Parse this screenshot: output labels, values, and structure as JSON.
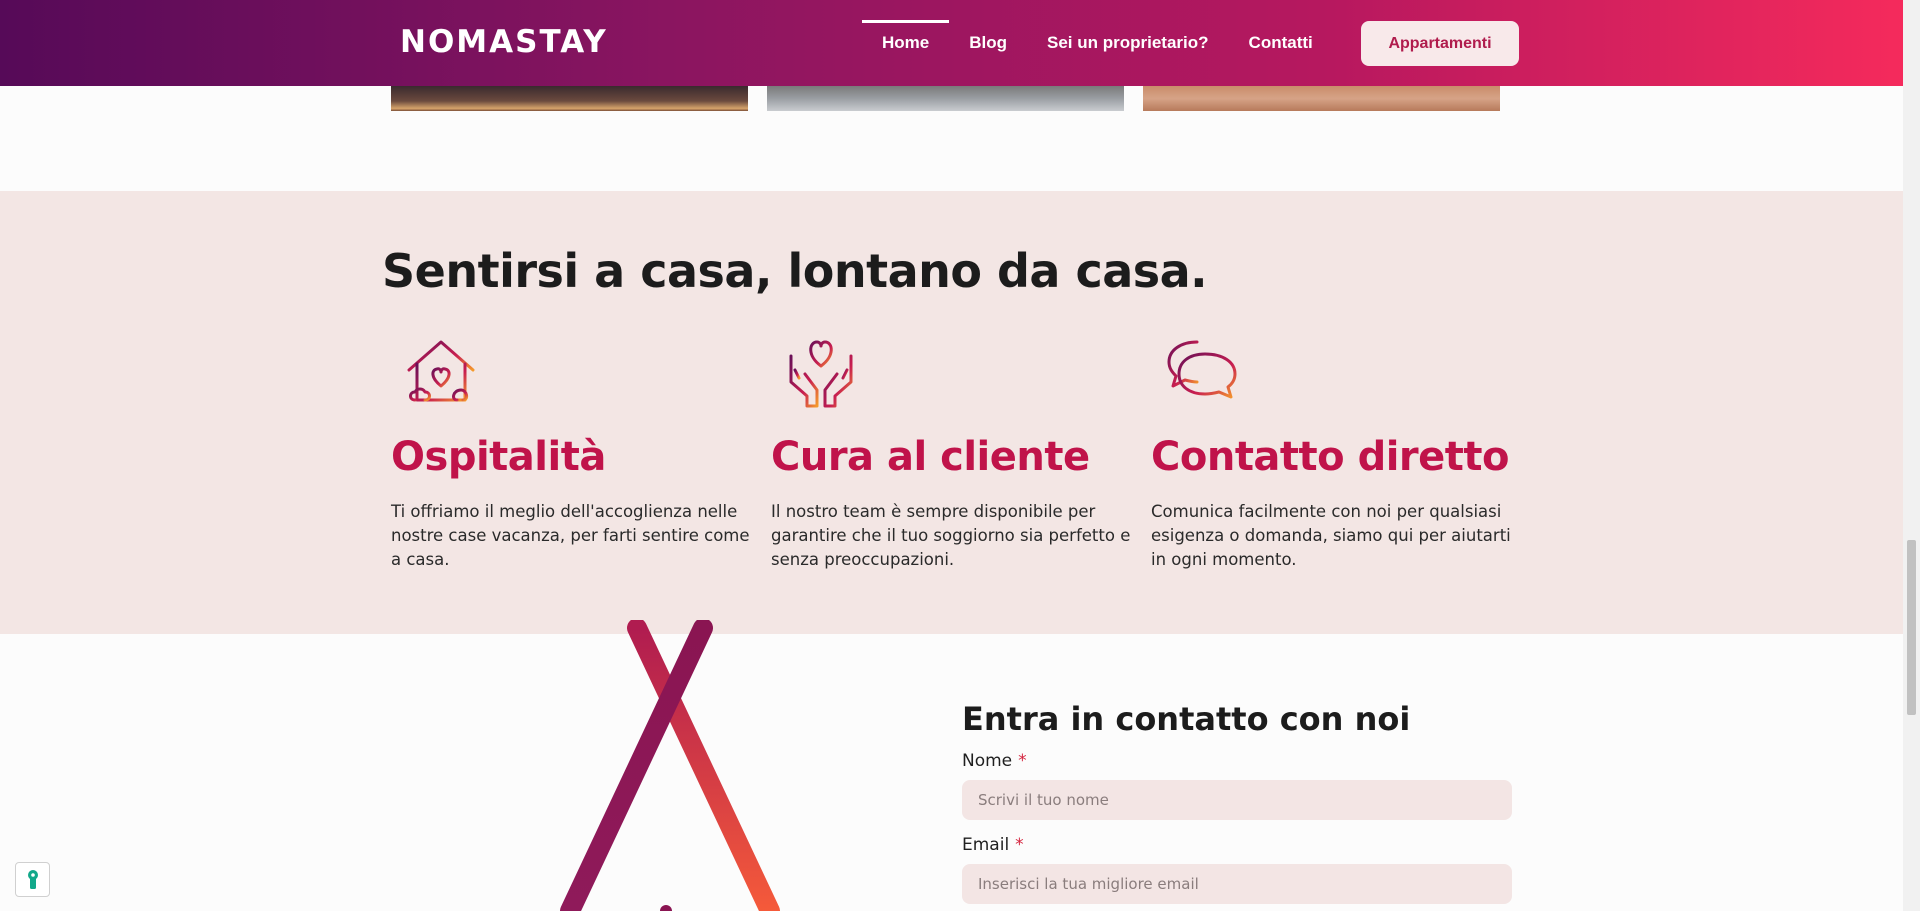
{
  "header": {
    "logo": "NOMASTAY",
    "nav": [
      {
        "label": "Home",
        "active": true
      },
      {
        "label": "Blog",
        "active": false
      },
      {
        "label": "Sei un proprietario?",
        "active": false
      },
      {
        "label": "Contatti",
        "active": false
      }
    ],
    "cta_label": "Appartamenti"
  },
  "features": {
    "title": "Sentirsi a casa, lontano da casa.",
    "items": [
      {
        "icon": "house-heart-icon",
        "title": "Ospitalità",
        "text": "Ti offriamo il meglio dell'accoglienza nelle nostre case vacanza, per farti sentire come a casa."
      },
      {
        "icon": "hands-heart-icon",
        "title": "Cura al cliente",
        "text": "Il nostro team è sempre disponibile per garantire che il tuo soggiorno sia perfetto e senza preoccupazioni."
      },
      {
        "icon": "chat-bubbles-icon",
        "title": "Contatto diretto",
        "text": "Comunica facilmente con noi per qualsiasi esigenza o domanda, siamo qui per aiutarti in ogni momento."
      }
    ]
  },
  "contact": {
    "title": "Entra in contatto con noi",
    "fields": [
      {
        "label": "Nome",
        "required_mark": "*",
        "placeholder": "Scrivi il tuo nome"
      },
      {
        "label": "Email",
        "required_mark": "*",
        "placeholder": "Inserisci la tua migliore email"
      }
    ]
  },
  "colors": {
    "accent": "#c0134a",
    "section_bg": "#f3e6e4",
    "header_start": "#560a58",
    "header_end": "#f52a5c"
  }
}
